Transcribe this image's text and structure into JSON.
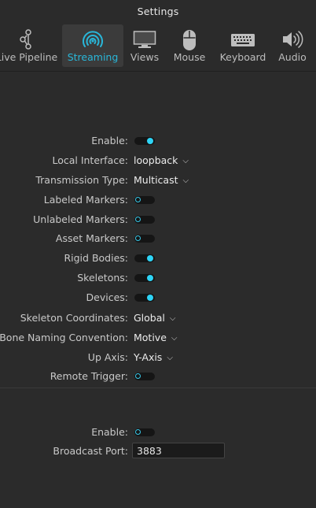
{
  "window": {
    "title": "Settings"
  },
  "tabs": [
    {
      "label": "Live Pipeline",
      "icon": "pipeline-icon",
      "active": false
    },
    {
      "label": "Streaming",
      "icon": "streaming-icon",
      "active": true
    },
    {
      "label": "Views",
      "icon": "monitor-icon",
      "active": false
    },
    {
      "label": "Mouse",
      "icon": "mouse-icon",
      "active": false
    },
    {
      "label": "Keyboard",
      "icon": "keyboard-icon",
      "active": false
    },
    {
      "label": "Audio",
      "icon": "speaker-icon",
      "active": false
    }
  ],
  "streaming": {
    "enable": {
      "label": "Enable:",
      "on": true
    },
    "local_interface": {
      "label": "Local Interface:",
      "value": "loopback"
    },
    "transmission_type": {
      "label": "Transmission Type:",
      "value": "Multicast"
    },
    "labeled_markers": {
      "label": "Labeled Markers:",
      "on": false
    },
    "unlabeled_markers": {
      "label": "Unlabeled Markers:",
      "on": false
    },
    "asset_markers": {
      "label": "Asset Markers:",
      "on": false
    },
    "rigid_bodies": {
      "label": "Rigid Bodies:",
      "on": true
    },
    "skeletons": {
      "label": "Skeletons:",
      "on": true
    },
    "devices": {
      "label": "Devices:",
      "on": true
    },
    "skeleton_coordinates": {
      "label": "Skeleton Coordinates:",
      "value": "Global"
    },
    "bone_naming": {
      "label": "Bone Naming Convention:",
      "value": "Motive"
    },
    "up_axis": {
      "label": "Up Axis:",
      "value": "Y-Axis"
    },
    "remote_trigger": {
      "label": "Remote Trigger:",
      "on": false
    }
  },
  "broadcast": {
    "enable": {
      "label": "Enable:",
      "on": false
    },
    "port": {
      "label": "Broadcast Port:",
      "value": "3883"
    }
  },
  "colors": {
    "accent": "#29b7d9",
    "toggle_on": "#2ed4f6",
    "background": "#2b2b2b"
  }
}
